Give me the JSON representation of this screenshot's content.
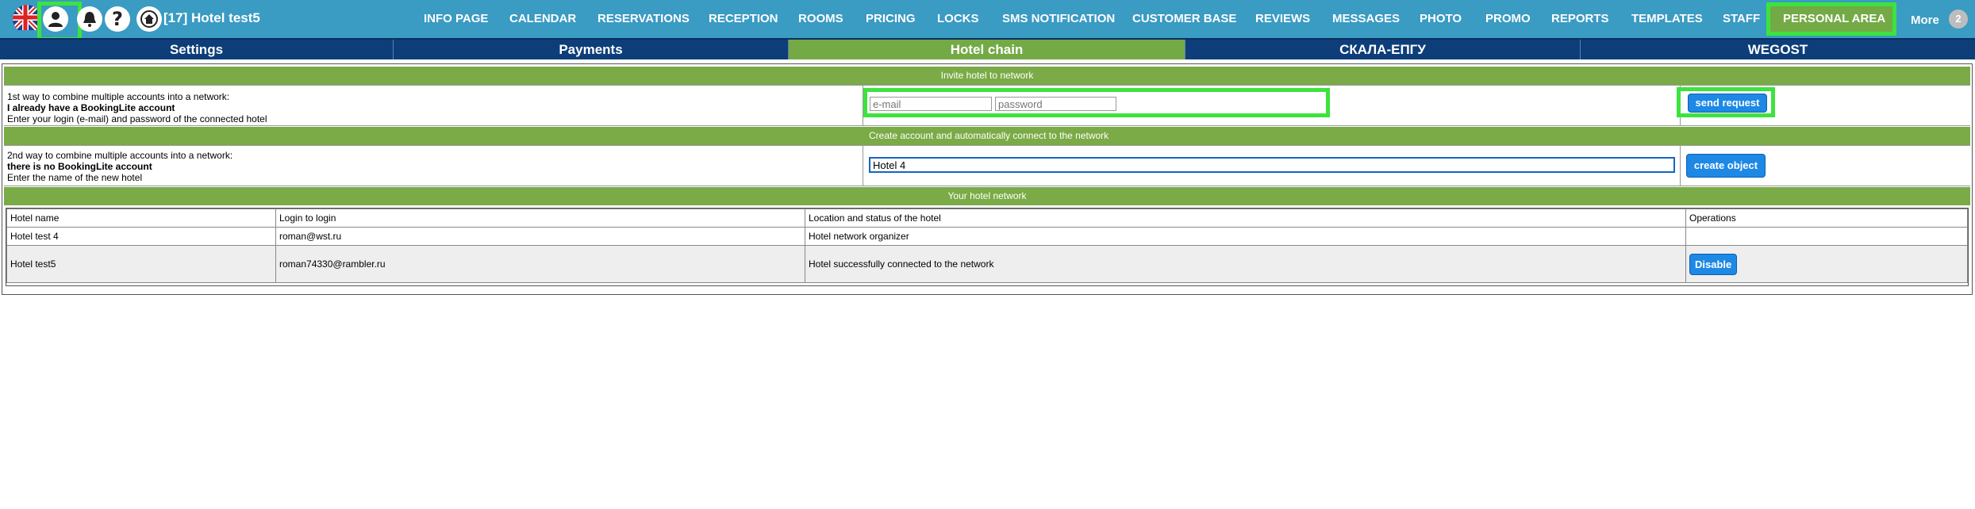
{
  "header": {
    "hotel_title": "[17] Hotel test5",
    "icons": [
      "uk-flag-icon",
      "user-icon",
      "bell-icon",
      "help-icon",
      "home-icon"
    ],
    "nav_items": [
      "INFO PAGE",
      "CALENDAR",
      "RESERVATIONS",
      "RECEPTION",
      "ROOMS",
      "PRICING",
      "LOCKS",
      "SMS NOTIFICATION",
      "CUSTOMER BASE",
      "REVIEWS",
      "MESSAGES",
      "PHOTO",
      "PROMO",
      "REPORTS",
      "TEMPLATES",
      "STAFF",
      "PERSONAL AREA"
    ],
    "active_nav": "PERSONAL AREA",
    "more_label": "More",
    "more_count": "2"
  },
  "subtabs": {
    "items": [
      "Settings",
      "Payments",
      "Hotel chain",
      "СКАЛА-ЕПГУ",
      "WEGOST"
    ],
    "active": "Hotel chain"
  },
  "invite": {
    "band_title": "Invite hotel to network",
    "line1": "1st way to combine multiple accounts into a network:",
    "line2": "I already have a BookingLite account",
    "line3": "Enter your login (e-mail) and password of the connected hotel",
    "email_placeholder": "e-mail",
    "password_placeholder": "password",
    "button": "send request"
  },
  "create": {
    "band_title": "Create account and automatically connect to the network",
    "line1": "2nd way to combine multiple accounts into a network:",
    "line2": "there is no BookingLite account",
    "line3": "Enter the name of the new hotel",
    "name_value": "Hotel 4",
    "button": "create object"
  },
  "network": {
    "band_title": "Your hotel network",
    "columns": [
      "Hotel name",
      "Login to login",
      "Location and status of the hotel",
      "Operations"
    ],
    "rows": [
      {
        "name": "Hotel test 4",
        "login": "roman@wst.ru",
        "status": "Hotel network organizer",
        "op": ""
      },
      {
        "name": "Hotel test5",
        "login": "roman74330@rambler.ru",
        "status": "Hotel successfully connected to the network",
        "op": "Disable"
      }
    ]
  },
  "colors": {
    "topbar": "#3a9bc3",
    "subtabs": "#0e3e7a",
    "green_band": "#7aab46",
    "button_blue": "#1e88e5",
    "highlight_green": "#3de33d"
  }
}
